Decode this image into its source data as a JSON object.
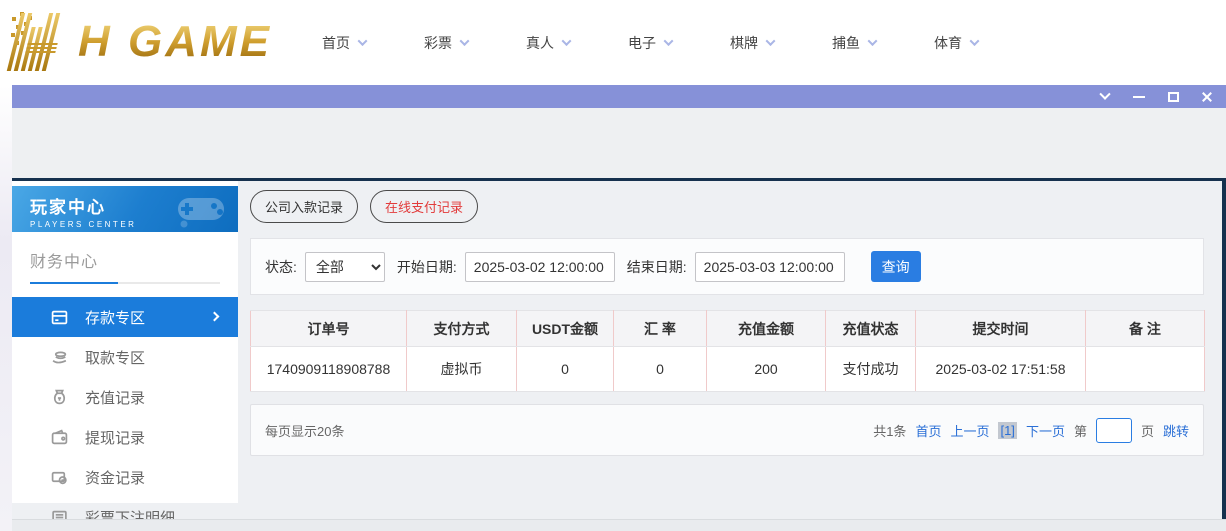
{
  "brand": {
    "logo_text": "H GAME"
  },
  "nav": {
    "items": [
      {
        "label": "首页"
      },
      {
        "label": "彩票"
      },
      {
        "label": "真人"
      },
      {
        "label": "电子"
      },
      {
        "label": "棋牌"
      },
      {
        "label": "捕鱼"
      },
      {
        "label": "体育"
      }
    ]
  },
  "titlebar": {
    "controls": [
      "collapse",
      "minimize",
      "maximize",
      "close"
    ]
  },
  "sidebar": {
    "title": "玩家中心",
    "subtitle": "PLAYERS CENTER",
    "section_title": "财务中心",
    "items": [
      {
        "label": "存款专区",
        "icon": "deposit-card-icon",
        "active": true
      },
      {
        "label": "取款专区",
        "icon": "withdraw-hand-icon",
        "active": false
      },
      {
        "label": "充值记录",
        "icon": "moneybag-icon",
        "active": false
      },
      {
        "label": "提现记录",
        "icon": "wallet-icon",
        "active": false
      },
      {
        "label": "资金记录",
        "icon": "fund-card-icon",
        "active": false
      },
      {
        "label": "彩票下注明细",
        "icon": "list-icon",
        "active": false
      }
    ]
  },
  "tabs": {
    "items": [
      {
        "label": "公司入款记录",
        "active": false
      },
      {
        "label": "在线支付记录",
        "active": true
      }
    ]
  },
  "filters": {
    "status_label": "状态:",
    "status_value": "全部",
    "start_label": "开始日期:",
    "start_value": "2025-03-02 12:00:00",
    "end_label": "结束日期:",
    "end_value": "2025-03-03 12:00:00",
    "search_button": "查询"
  },
  "table": {
    "headers": [
      "订单号",
      "支付方式",
      "USDT金额",
      "汇 率",
      "充值金额",
      "充值状态",
      "提交时间",
      "备 注"
    ],
    "rows": [
      {
        "order_no": "1740909118908788",
        "pay_method": "虚拟币",
        "usdt_amount": "0",
        "rate": "0",
        "amount": "200",
        "status": "支付成功",
        "submit_time": "2025-03-02 17:51:58",
        "remark": ""
      }
    ]
  },
  "pagination": {
    "page_size_text": "每页显示20条",
    "total_text": "共1条",
    "first_label": "首页",
    "prev_label": "上一页",
    "current_page": "[1]",
    "next_label": "下一页",
    "jump_prefix": "第",
    "jump_suffix": "页",
    "jump_button": "跳转",
    "jump_value": ""
  },
  "colors": {
    "accent_blue": "#1b7cdb",
    "titlebar_purple": "#8691d8",
    "active_tab_red": "#e23b3b",
    "link_blue": "#2a6fd6",
    "query_button_blue": "#2a7de2",
    "gold_light": "#f2d77e",
    "gold_dark": "#8f6008",
    "sidebar_gradient_start": "#4aa8e6",
    "sidebar_gradient_end": "#0e6dbf",
    "table_divider_pink": "#f0caca"
  }
}
